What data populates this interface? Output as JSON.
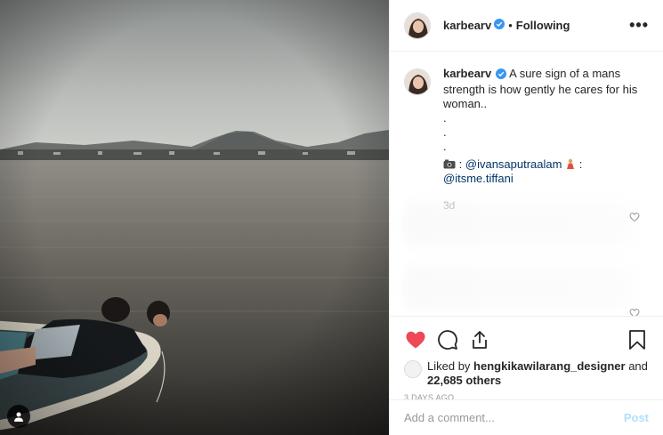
{
  "post": {
    "username": "karbearv",
    "follow_label": "Following",
    "separator": "•",
    "more_label": "•••"
  },
  "caption": {
    "username": "karbearv",
    "text": "A sure sign of a mans strength is how gently he cares for his woman..",
    "dots": [
      ".",
      ".",
      "."
    ],
    "photo_credit_mention": "@ivansaputraalam",
    "model_mention": "@itsme.tiffani",
    "credit_sep": ":",
    "time_ago": "3d"
  },
  "likes": {
    "prefix": "Liked by",
    "liker": "hengkikawilarang_designer",
    "conjunction": "and",
    "others": "22,685 others"
  },
  "date": "3 DAYS AGO",
  "comment_box": {
    "placeholder": "Add a comment...",
    "post_label": "Post"
  },
  "icons": {
    "like": "heart-icon",
    "comment": "comment-icon",
    "share": "share-icon",
    "save": "bookmark-icon",
    "verified": "verified-badge-icon",
    "tag": "user-tag-icon",
    "camera": "camera-emoji-icon",
    "model": "dancer-emoji-icon"
  },
  "colors": {
    "like_red": "#ed4956",
    "verified_blue": "#3897f0",
    "mention_blue": "#003569",
    "post_disabled": "#b2dffc"
  }
}
